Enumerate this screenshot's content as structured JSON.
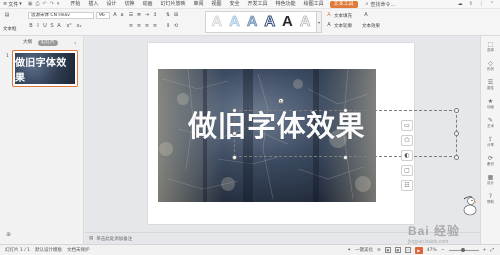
{
  "titlebar": {
    "file_menu": "文件",
    "file_arrow": "▾",
    "tabs": [
      "开始",
      "插入",
      "设计",
      "切换",
      "动画",
      "幻灯片放映",
      "审阅",
      "视图",
      "安全",
      "开发工具",
      "特色功能",
      "绘图工具",
      "文本工具"
    ],
    "active_tab": "文本工具",
    "search_label": "查找命令..."
  },
  "ribbon": {
    "font_name": "思源宋体 CN Heav",
    "font_size": "96",
    "font_label": "文本框",
    "text_effect": "文本填充",
    "text_outline": "文本轮廓",
    "text_effect_label": "文本效果",
    "art_samples": [
      "A",
      "A",
      "A",
      "A",
      "A",
      "A"
    ]
  },
  "leftpanel": {
    "tabs": [
      "大纲",
      "幻灯片"
    ],
    "active_tab": "幻灯片",
    "slide_number": "1",
    "thumb_text": "做旧字体效果"
  },
  "slide": {
    "title_text": "做旧字体效果"
  },
  "notes": {
    "placeholder": "单击此处添加备注"
  },
  "rightbar": {
    "items": [
      "选择",
      "形状",
      "属性",
      "动画",
      "艺术",
      "分享",
      "备份",
      "设计",
      "帮助"
    ]
  },
  "statusbar": {
    "slide_info": "幻灯片 1 / 1",
    "theme": "默认设计模板",
    "doc_status": "文档未保护",
    "remarks": "一键美化",
    "zoom": "47%"
  },
  "watermark": {
    "text": "Bai 经验",
    "sub": "jingyan.baidu.com"
  },
  "colors": {
    "accent": "#e07a3a",
    "play": "#e0643a"
  }
}
